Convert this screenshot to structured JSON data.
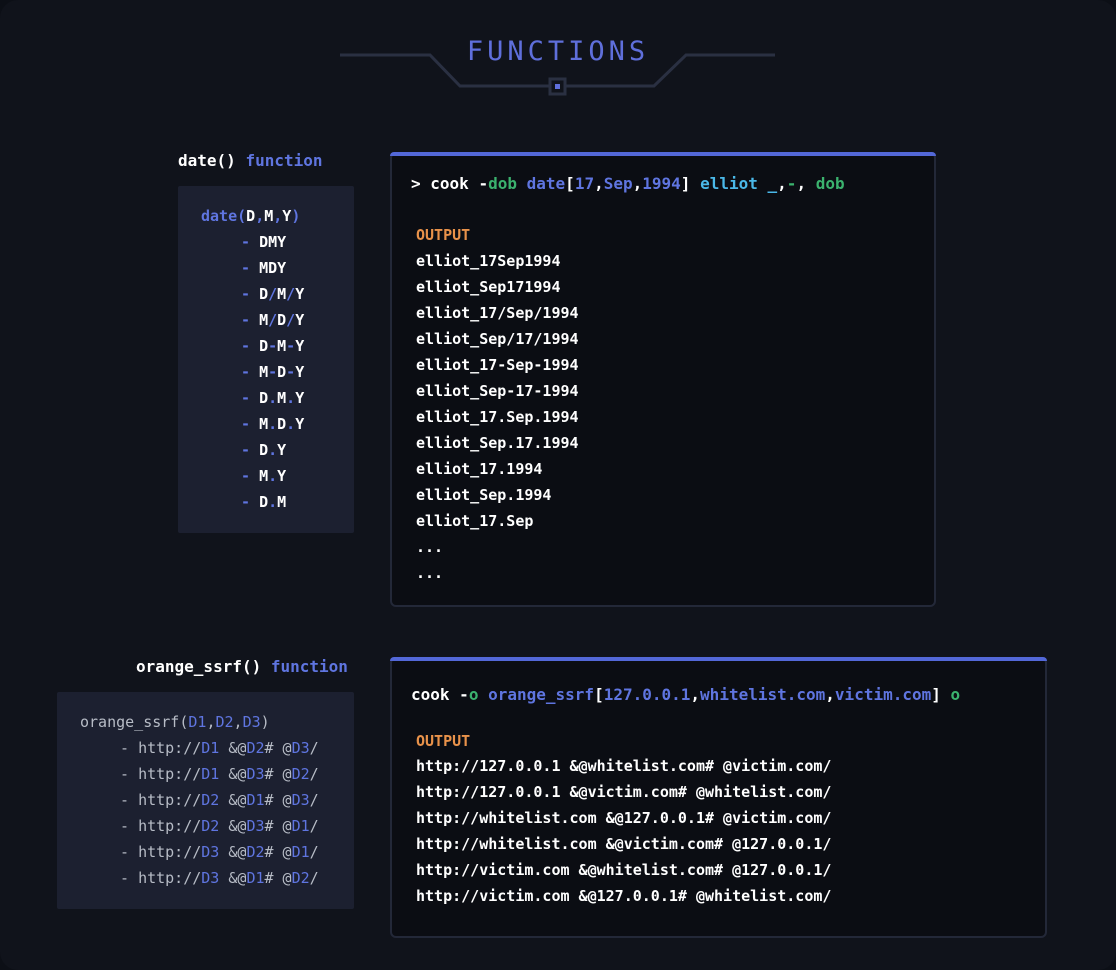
{
  "header": {
    "title": "FUNCTIONS"
  },
  "date_section": {
    "label_fn": "date()",
    "label_kw": "function",
    "signature": {
      "name": "date",
      "open": "(",
      "a": "D",
      "sep1": ",",
      "b": "M",
      "sep2": ",",
      "c": "Y",
      "close": ")"
    },
    "formats": [
      [
        "DMY"
      ],
      [
        "MDY"
      ],
      [
        "D",
        "/",
        "M",
        "/",
        "Y"
      ],
      [
        "M",
        "/",
        "D",
        "/",
        "Y"
      ],
      [
        "D",
        "-",
        "M",
        "-",
        "Y"
      ],
      [
        "M",
        "-",
        "D",
        "-",
        "Y"
      ],
      [
        "D",
        ".",
        "M",
        ".",
        "Y"
      ],
      [
        "M",
        ".",
        "D",
        ".",
        "Y"
      ],
      [
        "D",
        ".",
        "Y"
      ],
      [
        "M",
        ".",
        "Y"
      ],
      [
        "D",
        ".",
        "M"
      ]
    ],
    "dash": "-",
    "command": {
      "prompt": ">",
      "cook": "cook",
      "flag_dash": "-",
      "flag": "dob",
      "fn": "date",
      "lb": "[",
      "d": "17",
      "c1": ",",
      "m": "Sep",
      "c2": ",",
      "y": "1994",
      "rb": "]",
      "word": "elliot",
      "sep_a": "_",
      "sep_c1": ",",
      "sep_b": "-",
      "sep_c2": ",",
      "tail": "dob"
    },
    "output_label": "OUTPUT",
    "output": [
      "elliot_17Sep1994",
      "elliot_Sep171994",
      "elliot_17/Sep/1994",
      "elliot_Sep/17/1994",
      "elliot_17-Sep-1994",
      "elliot_Sep-17-1994",
      "elliot_17.Sep.1994",
      "elliot_Sep.17.1994",
      "elliot_17.1994",
      "elliot_Sep.1994",
      "elliot_17.Sep",
      "...",
      "..."
    ]
  },
  "ssrf_section": {
    "label_fn": "orange_ssrf()",
    "label_kw": "function",
    "signature": {
      "name": "orange_ssrf(",
      "a": "D1",
      "sep1": ",",
      "b": "D2",
      "sep2": ",",
      "c": "D3",
      "close": ")"
    },
    "dash": "-",
    "patterns": [
      [
        "http://",
        "D1",
        " &@",
        "D2",
        "# @",
        "D3",
        "/"
      ],
      [
        "http://",
        "D1",
        " &@",
        "D3",
        "# @",
        "D2",
        "/"
      ],
      [
        "http://",
        "D2",
        " &@",
        "D1",
        "# @",
        "D3",
        "/"
      ],
      [
        "http://",
        "D2",
        " &@",
        "D3",
        "# @",
        "D1",
        "/"
      ],
      [
        "http://",
        "D3",
        " &@",
        "D2",
        "# @",
        "D1",
        "/"
      ],
      [
        "http://",
        "D3",
        " &@",
        "D1",
        "# @",
        "D2",
        "/"
      ]
    ],
    "command": {
      "cook": "cook",
      "flag_dash": "-",
      "flag": "o",
      "fn": "orange_ssrf",
      "lb": "[",
      "a": "127.0.0.1",
      "c1": ",",
      "b": "whitelist.com",
      "c2": ",",
      "c": "victim.com",
      "rb": "]",
      "tail": "o"
    },
    "output_label": "OUTPUT",
    "output": [
      "http://127.0.0.1 &@whitelist.com# @victim.com/",
      "http://127.0.0.1 &@victim.com# @whitelist.com/",
      "http://whitelist.com &@127.0.0.1# @victim.com/",
      "http://whitelist.com &@victim.com# @127.0.0.1/",
      "http://victim.com &@whitelist.com# @127.0.0.1/",
      "http://victim.com &@127.0.0.1# @whitelist.com/"
    ]
  },
  "colors": {
    "accent": "#5f75e0",
    "flag": "#3bb26e",
    "word": "#4ab8e8",
    "output_label": "#e9924a",
    "background": "#10131b"
  }
}
